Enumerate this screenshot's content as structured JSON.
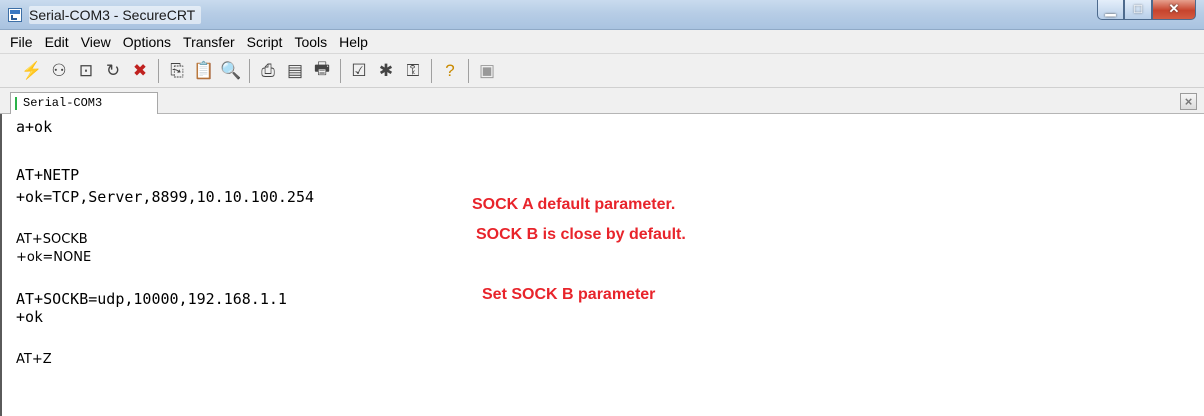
{
  "window": {
    "title": "Serial-COM3 - SecureCRT"
  },
  "menu": [
    "File",
    "Edit",
    "View",
    "Options",
    "Transfer",
    "Script",
    "Tools",
    "Help"
  ],
  "toolbar": {
    "icons": [
      "connect-icon",
      "quick-connect-icon",
      "connect-in-tab-icon",
      "reconnect-icon",
      "disconnect-icon",
      "copy-icon",
      "paste-icon",
      "find-icon",
      "print-icon",
      "print-selection-icon",
      "print-setup-icon",
      "session-options-icon",
      "global-options-icon",
      "key-generator-icon",
      "help-icon",
      "sftp-icon"
    ]
  },
  "tabs": [
    {
      "label": "Serial-COM3"
    }
  ],
  "terminal": {
    "lines": [
      "a+ok",
      "AT+NETP",
      "+ok=TCP,Server,8899,10.10.100.254",
      "AT+SOCKB",
      "+ok=NONE",
      "AT+SOCKB=udp,10000,192.168.1.1",
      "+ok",
      "AT+Z"
    ]
  },
  "annotations": [
    "SOCK A default parameter.",
    "SOCK B is close by default.",
    "Set SOCK B parameter"
  ],
  "colors": {
    "annotation": "#e8242b",
    "titlebar": "#b7cde6",
    "close": "#c7442d"
  }
}
